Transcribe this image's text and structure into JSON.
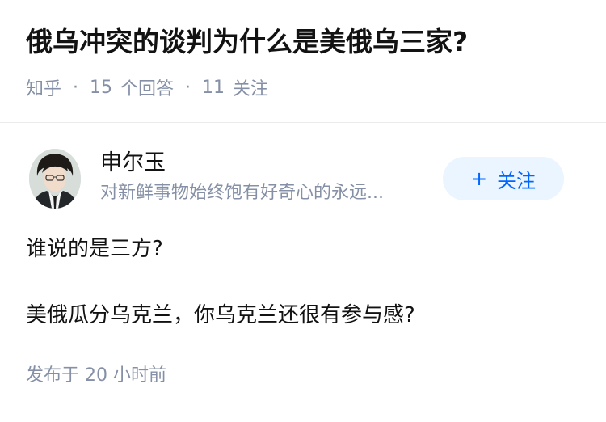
{
  "question": {
    "title": "俄乌冲突的谈判为什么是美俄乌三家?",
    "source": "知乎",
    "answers_count": "15",
    "answers_label": "个回答",
    "followers_count": "11",
    "followers_label": "关注"
  },
  "answer": {
    "author": {
      "name": "申尔玉",
      "bio": "对新鲜事物始终饱有好奇心的永远..."
    },
    "follow_button": {
      "icon": "plus-icon",
      "label": "关注",
      "accent_color": "#0066ff",
      "background": "#ebf5ff"
    },
    "paragraphs": [
      "谁说的是三方?",
      "美俄瓜分乌克兰，你乌克兰还很有参与感?"
    ],
    "posted_time": "发布于 20 小时前"
  }
}
